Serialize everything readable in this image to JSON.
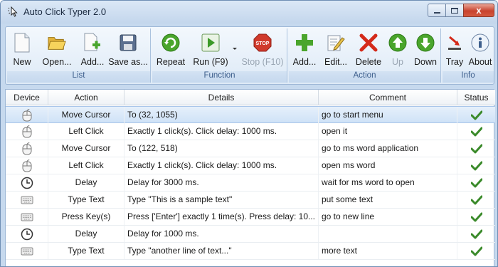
{
  "window": {
    "title": "Auto Click Typer 2.0",
    "controls": {
      "minimize_icon": "minimize-icon",
      "maximize_icon": "maximize-icon",
      "close_label": "x"
    }
  },
  "ribbon": {
    "groups": [
      {
        "label": "List",
        "buttons": [
          {
            "label": "New",
            "icon": "new-document-icon",
            "enabled": true
          },
          {
            "label": "Open...",
            "icon": "open-folder-icon",
            "enabled": true
          },
          {
            "label": "Add...",
            "icon": "add-document-icon",
            "enabled": true
          },
          {
            "label": "Save as...",
            "icon": "floppy-disk-icon",
            "enabled": true
          }
        ]
      },
      {
        "label": "Function",
        "buttons": [
          {
            "label": "Repeat",
            "icon": "repeat-icon",
            "enabled": true
          },
          {
            "label": "Run (F9)",
            "icon": "play-icon",
            "enabled": true
          },
          {
            "label": "Stop (F10)",
            "icon": "stop-sign-icon",
            "enabled": false
          }
        ]
      },
      {
        "label": "Action",
        "buttons": [
          {
            "label": "Add...",
            "icon": "plus-icon",
            "enabled": true
          },
          {
            "label": "Edit...",
            "icon": "edit-pencil-icon",
            "enabled": true
          },
          {
            "label": "Delete",
            "icon": "delete-x-icon",
            "enabled": true
          },
          {
            "label": "Up",
            "icon": "arrow-up-icon",
            "enabled": false
          },
          {
            "label": "Down",
            "icon": "arrow-down-icon",
            "enabled": true
          }
        ]
      },
      {
        "label": "Info",
        "buttons": [
          {
            "label": "Tray",
            "icon": "tray-icon",
            "enabled": true
          },
          {
            "label": "About",
            "icon": "info-icon",
            "enabled": true
          }
        ]
      }
    ]
  },
  "table": {
    "columns": [
      "Device",
      "Action",
      "Details",
      "Comment",
      "Status"
    ],
    "rows": [
      {
        "device": "mouse",
        "action": "Move Cursor",
        "details": "To (32, 1055)",
        "comment": "go to start menu",
        "status": "ok",
        "selected": true
      },
      {
        "device": "mouse",
        "action": "Left Click",
        "details": "Exactly 1 click(s). Click delay: 1000 ms.",
        "comment": "open it",
        "status": "ok"
      },
      {
        "device": "mouse",
        "action": "Move Cursor",
        "details": "To (122, 518)",
        "comment": "go to ms word application",
        "status": "ok"
      },
      {
        "device": "mouse",
        "action": "Left Click",
        "details": "Exactly 1 click(s). Click delay: 1000 ms.",
        "comment": "open ms word",
        "status": "ok"
      },
      {
        "device": "clock",
        "action": "Delay",
        "details": "Delay for 3000 ms.",
        "comment": "wait for ms word to open",
        "status": "ok"
      },
      {
        "device": "keyboard",
        "action": "Type Text",
        "details": "Type \"This is a sample text\"",
        "comment": "put some text",
        "status": "ok"
      },
      {
        "device": "keyboard",
        "action": "Press Key(s)",
        "details": "Press ['Enter'] exactly 1 time(s). Press delay: 10...",
        "comment": "go to new line",
        "status": "ok"
      },
      {
        "device": "clock",
        "action": "Delay",
        "details": "Delay for 1000 ms.",
        "comment": "",
        "status": "ok"
      },
      {
        "device": "keyboard",
        "action": "Type Text",
        "details": "Type \"another line of text...\"",
        "comment": "more text",
        "status": "ok"
      }
    ]
  },
  "colors": {
    "accent": "#3a8a2a",
    "selection": "#cfe2f7",
    "group_label": "#3e5f8c"
  }
}
